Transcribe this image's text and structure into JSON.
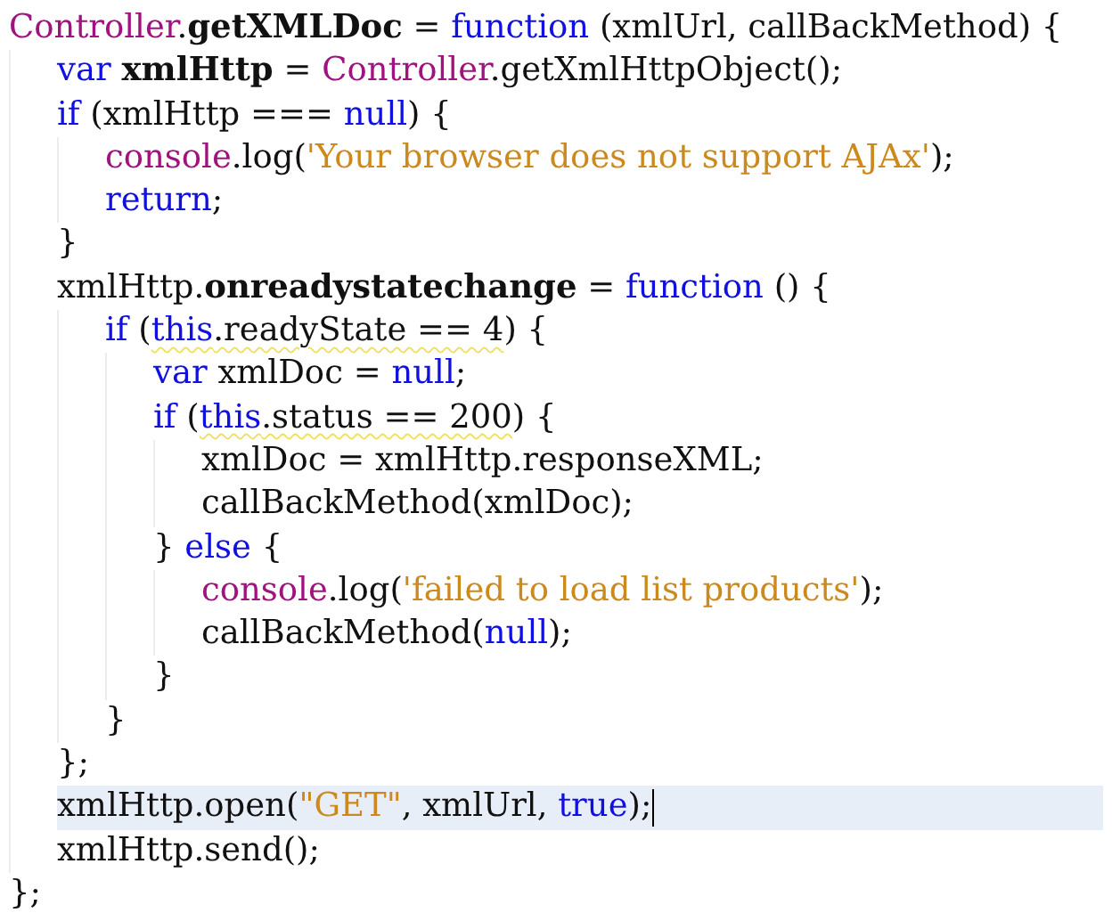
{
  "code": [
    {
      "current": false,
      "tokens": [
        {
          "kind": "object",
          "text": "Controller"
        },
        {
          "kind": "plain",
          "text": "."
        },
        {
          "kind": "bold",
          "text": "getXMLDoc"
        },
        {
          "kind": "plain",
          "text": " = "
        },
        {
          "kind": "keyword",
          "text": "function"
        },
        {
          "kind": "plain",
          "text": " (xmlUrl, callBackMethod) {"
        }
      ],
      "children": [
        {
          "current": false,
          "tokens": [
            {
              "kind": "keyword",
              "text": "var "
            },
            {
              "kind": "bold",
              "text": "xmlHttp"
            },
            {
              "kind": "plain",
              "text": " = "
            },
            {
              "kind": "object",
              "text": "Controller"
            },
            {
              "kind": "plain",
              "text": ".getXmlHttpObject();"
            }
          ]
        },
        {
          "current": false,
          "tokens": [
            {
              "kind": "keyword",
              "text": "if"
            },
            {
              "kind": "plain",
              "text": " (xmlHttp === "
            },
            {
              "kind": "keyword",
              "text": "null"
            },
            {
              "kind": "plain",
              "text": ") {"
            }
          ],
          "children": [
            {
              "current": false,
              "tokens": [
                {
                  "kind": "object",
                  "text": "console"
                },
                {
                  "kind": "plain",
                  "text": ".log("
                },
                {
                  "kind": "string",
                  "text": "'Your browser does not support AJAx'"
                },
                {
                  "kind": "plain",
                  "text": ");"
                }
              ]
            },
            {
              "current": false,
              "tokens": [
                {
                  "kind": "keyword",
                  "text": "return"
                },
                {
                  "kind": "plain",
                  "text": ";"
                }
              ]
            }
          ]
        },
        {
          "current": false,
          "tokens": [
            {
              "kind": "plain",
              "text": "}"
            }
          ]
        },
        {
          "current": false,
          "tokens": [
            {
              "kind": "plain",
              "text": "xmlHttp."
            },
            {
              "kind": "bold",
              "text": "onreadystatechange"
            },
            {
              "kind": "plain",
              "text": " = "
            },
            {
              "kind": "keyword",
              "text": "function"
            },
            {
              "kind": "plain",
              "text": " () {"
            }
          ],
          "children": [
            {
              "current": false,
              "tokens": [
                {
                  "kind": "keyword",
                  "text": "if"
                },
                {
                  "kind": "plain",
                  "text": " ("
                },
                {
                  "kind": "keyword",
                  "text": "this",
                  "warning": true
                },
                {
                  "kind": "plain",
                  "text": ".readyState == 4",
                  "warning": true
                },
                {
                  "kind": "plain",
                  "text": ") {"
                }
              ],
              "children": [
                {
                  "current": false,
                  "tokens": [
                    {
                      "kind": "keyword",
                      "text": "var"
                    },
                    {
                      "kind": "plain",
                      "text": " xmlDoc = "
                    },
                    {
                      "kind": "keyword",
                      "text": "null"
                    },
                    {
                      "kind": "plain",
                      "text": ";"
                    }
                  ]
                },
                {
                  "current": false,
                  "tokens": [
                    {
                      "kind": "keyword",
                      "text": "if"
                    },
                    {
                      "kind": "plain",
                      "text": " ("
                    },
                    {
                      "kind": "keyword",
                      "text": "this",
                      "warning": true
                    },
                    {
                      "kind": "plain",
                      "text": ".status == 200",
                      "warning": true
                    },
                    {
                      "kind": "plain",
                      "text": ") {"
                    }
                  ],
                  "children": [
                    {
                      "current": false,
                      "tokens": [
                        {
                          "kind": "plain",
                          "text": "xmlDoc = xmlHttp.responseXML;"
                        }
                      ]
                    },
                    {
                      "current": false,
                      "tokens": [
                        {
                          "kind": "plain",
                          "text": "callBackMethod(xmlDoc);"
                        }
                      ]
                    }
                  ]
                },
                {
                  "current": false,
                  "tokens": [
                    {
                      "kind": "plain",
                      "text": "} "
                    },
                    {
                      "kind": "keyword",
                      "text": "else"
                    },
                    {
                      "kind": "plain",
                      "text": " {"
                    }
                  ],
                  "children": [
                    {
                      "current": false,
                      "tokens": [
                        {
                          "kind": "object",
                          "text": "console"
                        },
                        {
                          "kind": "plain",
                          "text": ".log("
                        },
                        {
                          "kind": "string",
                          "text": "'failed to load list products'"
                        },
                        {
                          "kind": "plain",
                          "text": ");"
                        }
                      ]
                    },
                    {
                      "current": false,
                      "tokens": [
                        {
                          "kind": "plain",
                          "text": "callBackMethod("
                        },
                        {
                          "kind": "keyword",
                          "text": "null"
                        },
                        {
                          "kind": "plain",
                          "text": ");"
                        }
                      ]
                    }
                  ]
                },
                {
                  "current": false,
                  "tokens": [
                    {
                      "kind": "plain",
                      "text": "}"
                    }
                  ]
                }
              ]
            },
            {
              "current": false,
              "tokens": [
                {
                  "kind": "plain",
                  "text": "}"
                }
              ]
            }
          ]
        },
        {
          "current": false,
          "tokens": [
            {
              "kind": "plain",
              "text": "};"
            }
          ]
        },
        {
          "current": true,
          "tokens": [
            {
              "kind": "plain",
              "text": "xmlHttp.open("
            },
            {
              "kind": "string",
              "text": "\"GET\""
            },
            {
              "kind": "plain",
              "text": ", xmlUrl, "
            },
            {
              "kind": "keyword",
              "text": "true"
            },
            {
              "kind": "plain",
              "text": ");"
            }
          ]
        },
        {
          "current": false,
          "tokens": [
            {
              "kind": "plain",
              "text": "xmlHttp.send();"
            }
          ]
        }
      ]
    },
    {
      "current": false,
      "tokens": [
        {
          "kind": "plain",
          "text": "};"
        }
      ]
    }
  ]
}
